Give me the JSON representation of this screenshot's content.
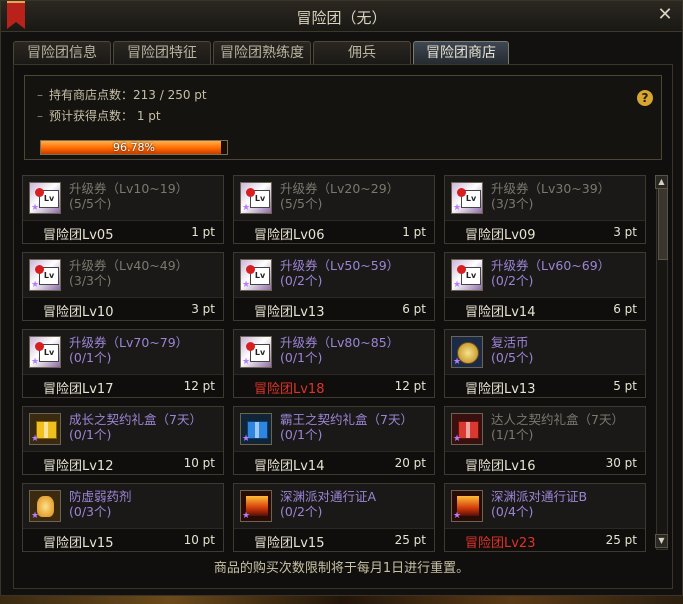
{
  "window": {
    "title": "冒险团（无）",
    "close_symbol": "✕"
  },
  "tabs": [
    {
      "label": "冒险团信息",
      "active": false
    },
    {
      "label": "冒险团特征",
      "active": false
    },
    {
      "label": "冒险团熟练度",
      "active": false
    },
    {
      "label": "佣兵",
      "active": false
    },
    {
      "label": "冒险团商店",
      "active": true
    }
  ],
  "points": {
    "held_label": "持有商店点数：213 / 250 pt",
    "expected_label": "预计获得点数：  1 pt",
    "progress_text": "96.78%",
    "progress_fraction": 0.9678,
    "help_symbol": "?"
  },
  "items": [
    {
      "name": "升级券（Lv10~19）",
      "qty": "(5/5个)",
      "level": "冒险团Lv05",
      "cost": "1 pt",
      "icon": "ticket-icon",
      "state": "sold",
      "locked": false
    },
    {
      "name": "升级券（Lv20~29）",
      "qty": "(5/5个)",
      "level": "冒险团Lv06",
      "cost": "1 pt",
      "icon": "ticket-icon",
      "state": "sold",
      "locked": false
    },
    {
      "name": "升级券（Lv30~39）",
      "qty": "(3/3个)",
      "level": "冒险团Lv09",
      "cost": "3 pt",
      "icon": "ticket-icon",
      "state": "sold",
      "locked": false
    },
    {
      "name": "升级券（Lv40~49）",
      "qty": "(3/3个)",
      "level": "冒险团Lv10",
      "cost": "3 pt",
      "icon": "ticket-icon",
      "state": "sold",
      "locked": false
    },
    {
      "name": "升级券（Lv50~59）",
      "qty": "(0/2个)",
      "level": "冒险团Lv13",
      "cost": "6 pt",
      "icon": "ticket-icon",
      "state": "avail",
      "locked": false
    },
    {
      "name": "升级券（Lv60~69）",
      "qty": "(0/2个)",
      "level": "冒险团Lv14",
      "cost": "6 pt",
      "icon": "ticket-icon",
      "state": "avail",
      "locked": false
    },
    {
      "name": "升级券（Lv70~79）",
      "qty": "(0/1个)",
      "level": "冒险团Lv17",
      "cost": "12 pt",
      "icon": "ticket-icon",
      "state": "avail",
      "locked": false
    },
    {
      "name": "升级券（Lv80~85）",
      "qty": "(0/1个)",
      "level": "冒险团Lv18",
      "cost": "12 pt",
      "icon": "ticket-icon",
      "state": "avail",
      "locked": true
    },
    {
      "name": "复活币",
      "qty": "(0/5个)",
      "level": "冒险团Lv13",
      "cost": "5 pt",
      "icon": "coin-icon",
      "state": "avail",
      "locked": false
    },
    {
      "name": "成长之契约礼盒（7天）",
      "qty": "(0/1个)",
      "level": "冒险团Lv12",
      "cost": "10 pt",
      "icon": "gold-gift-icon",
      "state": "avail",
      "locked": false
    },
    {
      "name": "霸王之契约礼盒（7天）",
      "qty": "(0/1个)",
      "level": "冒险团Lv14",
      "cost": "20 pt",
      "icon": "blue-gift-icon",
      "state": "avail",
      "locked": false
    },
    {
      "name": "达人之契约礼盒（7天）",
      "qty": "(1/1个)",
      "level": "冒险团Lv16",
      "cost": "30 pt",
      "icon": "red-gift-icon",
      "state": "sold",
      "locked": false
    },
    {
      "name": "防虚弱药剂",
      "qty": "(0/3个)",
      "level": "冒险团Lv15",
      "cost": "10 pt",
      "icon": "potion-icon",
      "state": "avail",
      "locked": false
    },
    {
      "name": "深渊派对通行证A",
      "qty": "(0/2个)",
      "level": "冒险团Lv15",
      "cost": "25 pt",
      "icon": "pass-icon",
      "state": "avail",
      "locked": false
    },
    {
      "name": "深渊派对通行证B",
      "qty": "(0/4个)",
      "level": "冒险团Lv23",
      "cost": "25 pt",
      "icon": "pass-icon",
      "state": "avail",
      "locked": true
    }
  ],
  "notice": "商品的购买次数限制将于每月1日进行重置。",
  "scroll": {
    "up": "▲",
    "down": "▼"
  },
  "colors": {
    "available_text": "#9c84d6",
    "sold_out_text": "#7c786e",
    "locked_level_text": "#e03228",
    "progress_bar": "#ff6a00"
  }
}
